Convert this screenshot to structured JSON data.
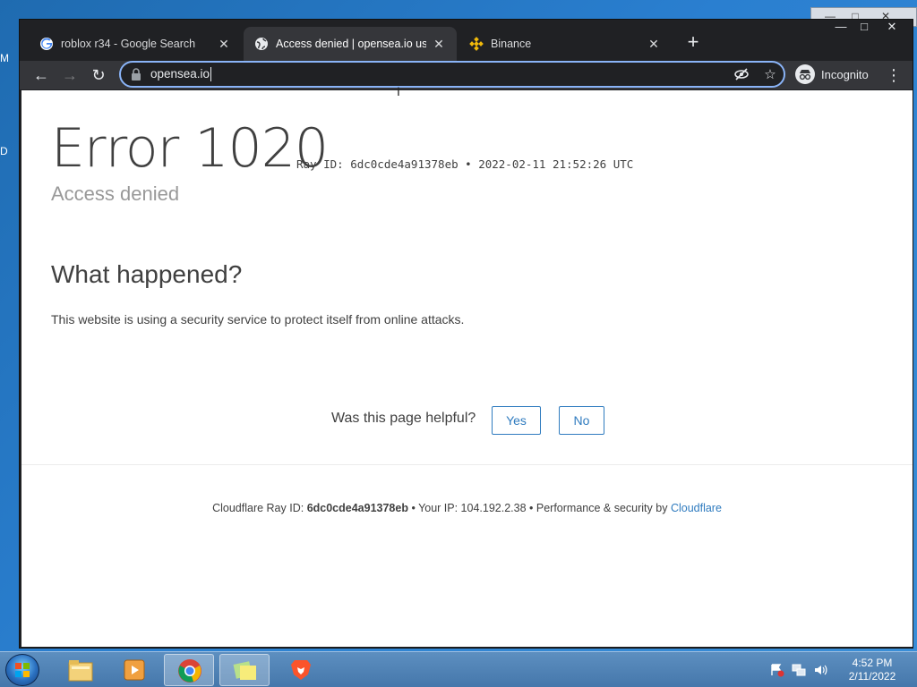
{
  "desktop": {
    "left_letters": [
      "M",
      "D"
    ]
  },
  "browser": {
    "tabs": [
      {
        "title": "roblox r34 - Google Search",
        "favicon": "google-icon",
        "active": false
      },
      {
        "title": "Access denied | opensea.io used",
        "favicon": "globe-icon",
        "active": true
      },
      {
        "title": "Binance",
        "favicon": "binance-icon",
        "active": false
      }
    ],
    "address": "opensea.io",
    "incognito_label": "Incognito"
  },
  "page": {
    "error_title": "Error 1020",
    "ray_line": "Ray ID: 6dc0cde4a91378eb • 2022-02-11 21:52:26 UTC",
    "access_denied": "Access denied",
    "what_heading": "What happened?",
    "what_text": "This website is using a security service to protect itself from online attacks.",
    "helpful_q": "Was this page helpful?",
    "yes": "Yes",
    "no": "No",
    "footer": {
      "ray_label": "Cloudflare Ray ID:",
      "ray_id": "6dc0cde4a91378eb",
      "ip_label": "• Your IP: 104.192.2.38 • Performance & security by",
      "cf_link": "Cloudflare"
    }
  },
  "taskbar": {
    "clock_time": "4:52 PM",
    "clock_date": "2/11/2022",
    "items": [
      "file-explorer-icon",
      "media-player-icon",
      "chrome-icon",
      "sticky-notes-icon",
      "brave-icon"
    ]
  },
  "colors": {
    "chrome_frame": "#202124",
    "toolbar": "#35363a",
    "focus_ring": "#8ab4f8",
    "cf_blue": "#2f7bbf",
    "text": "#404040"
  }
}
